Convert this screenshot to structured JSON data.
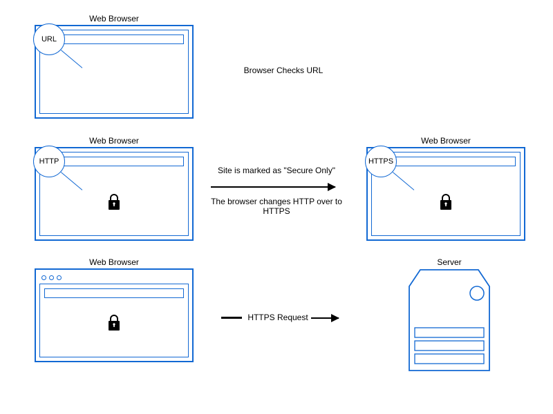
{
  "row1": {
    "browser_title": "Web Browser",
    "magnifier_text": "URL",
    "caption": "Browser Checks URL"
  },
  "row2": {
    "left_browser_title": "Web Browser",
    "left_magnifier_text": "HTTP",
    "right_browser_title": "Web Browser",
    "right_magnifier_text": "HTTPS",
    "caption_top": "Site is marked as \"Secure Only\"",
    "caption_bottom": "The browser changes HTTP over to HTTPS"
  },
  "row3": {
    "browser_title": "Web Browser",
    "server_title": "Server",
    "arrow_label": "HTTPS Request"
  }
}
